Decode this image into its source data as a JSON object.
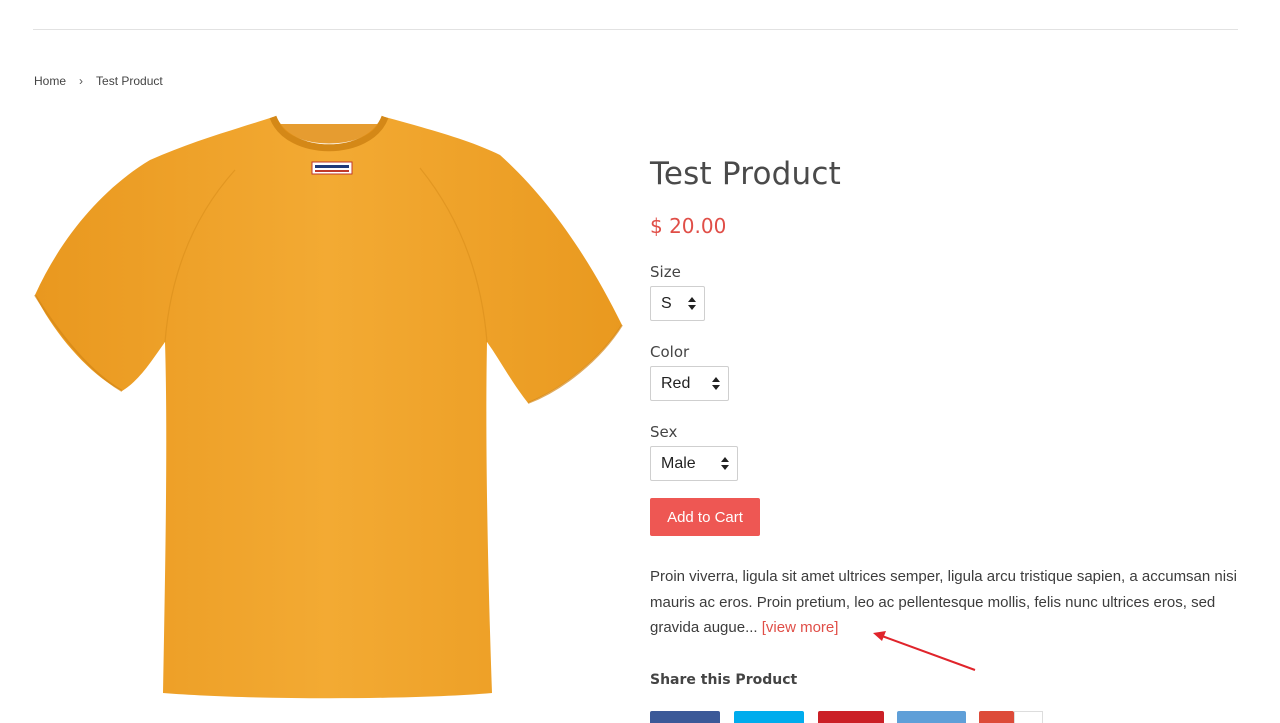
{
  "breadcrumb": {
    "home": "Home",
    "separator": "›",
    "current": "Test Product"
  },
  "product": {
    "title": "Test Product",
    "price": "$ 20.00",
    "image_icon": "tshirt-orange",
    "image_color": "#f2a62b"
  },
  "options": [
    {
      "label": "Size",
      "value": "S"
    },
    {
      "label": "Color",
      "value": "Red"
    },
    {
      "label": "Sex",
      "value": "Male"
    }
  ],
  "cart": {
    "button_label": "Add to Cart"
  },
  "description": {
    "text": "Proin viverra, ligula sit amet ultrices semper, ligula arcu tristique sapien, a accumsan nisi mauris ac eros. Proin pretium, leo ac pellentesque mollis, felis nunc ultrices eros, sed gravida augue... ",
    "view_more": "[view more]"
  },
  "share": {
    "title": "Share this Product",
    "buttons": [
      {
        "name": "facebook",
        "color": "#3b5998"
      },
      {
        "name": "twitter",
        "color": "#00aced"
      },
      {
        "name": "pinterest",
        "color": "#cb2027"
      },
      {
        "name": "fancy",
        "color": "#5f9fd8"
      },
      {
        "name": "google-plus",
        "color": "#dd4b39"
      }
    ]
  },
  "colors": {
    "accent": "#ee5753",
    "price": "#e04e47",
    "annotation_arrow": "#e0242b"
  }
}
